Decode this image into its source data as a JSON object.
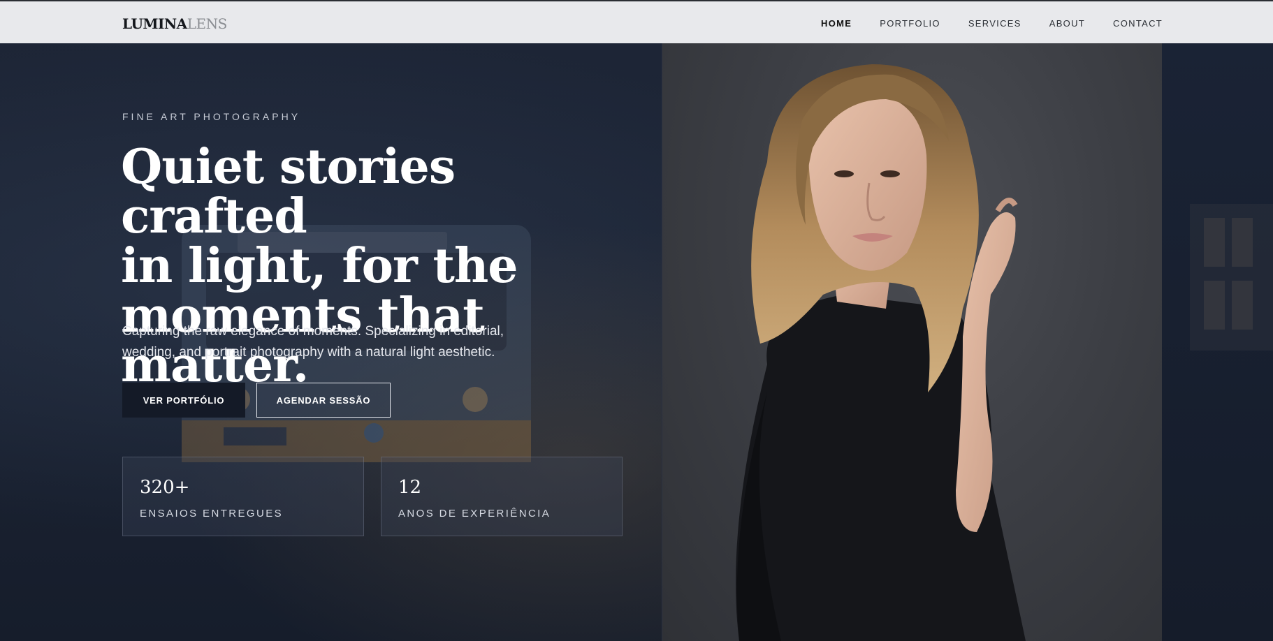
{
  "brand": {
    "logo_bold": "LUMINA",
    "logo_light": "LENS"
  },
  "nav": {
    "items": [
      {
        "label": "HOME",
        "active": true
      },
      {
        "label": "PORTFOLIO",
        "active": false
      },
      {
        "label": "SERVICES",
        "active": false
      },
      {
        "label": "ABOUT",
        "active": false
      },
      {
        "label": "CONTACT",
        "active": false
      }
    ]
  },
  "hero": {
    "kicker": "FINE ART PHOTOGRAPHY",
    "headline_line1": "Quiet stories crafted",
    "headline_line2": "in light, for the",
    "headline_line3": "moments that matter.",
    "subtitle": "Capturing the raw elegance of moments. Specializing in editorial, wedding, and portrait photography with a natural light aesthetic.",
    "primary_cta": "VER PORTFÓLIO",
    "secondary_cta": "AGENDAR SESSÃO"
  },
  "stats": [
    {
      "value": "320+",
      "label": "ENSAIOS ENTREGUES"
    },
    {
      "value": "12",
      "label": "ANOS DE EXPERIÊNCIA"
    }
  ],
  "colors": {
    "nav_bg": "#e8e9ec",
    "hero_bg": "#1a2233",
    "photo_bg": "#3d3f45",
    "text_light": "#ffffff"
  }
}
